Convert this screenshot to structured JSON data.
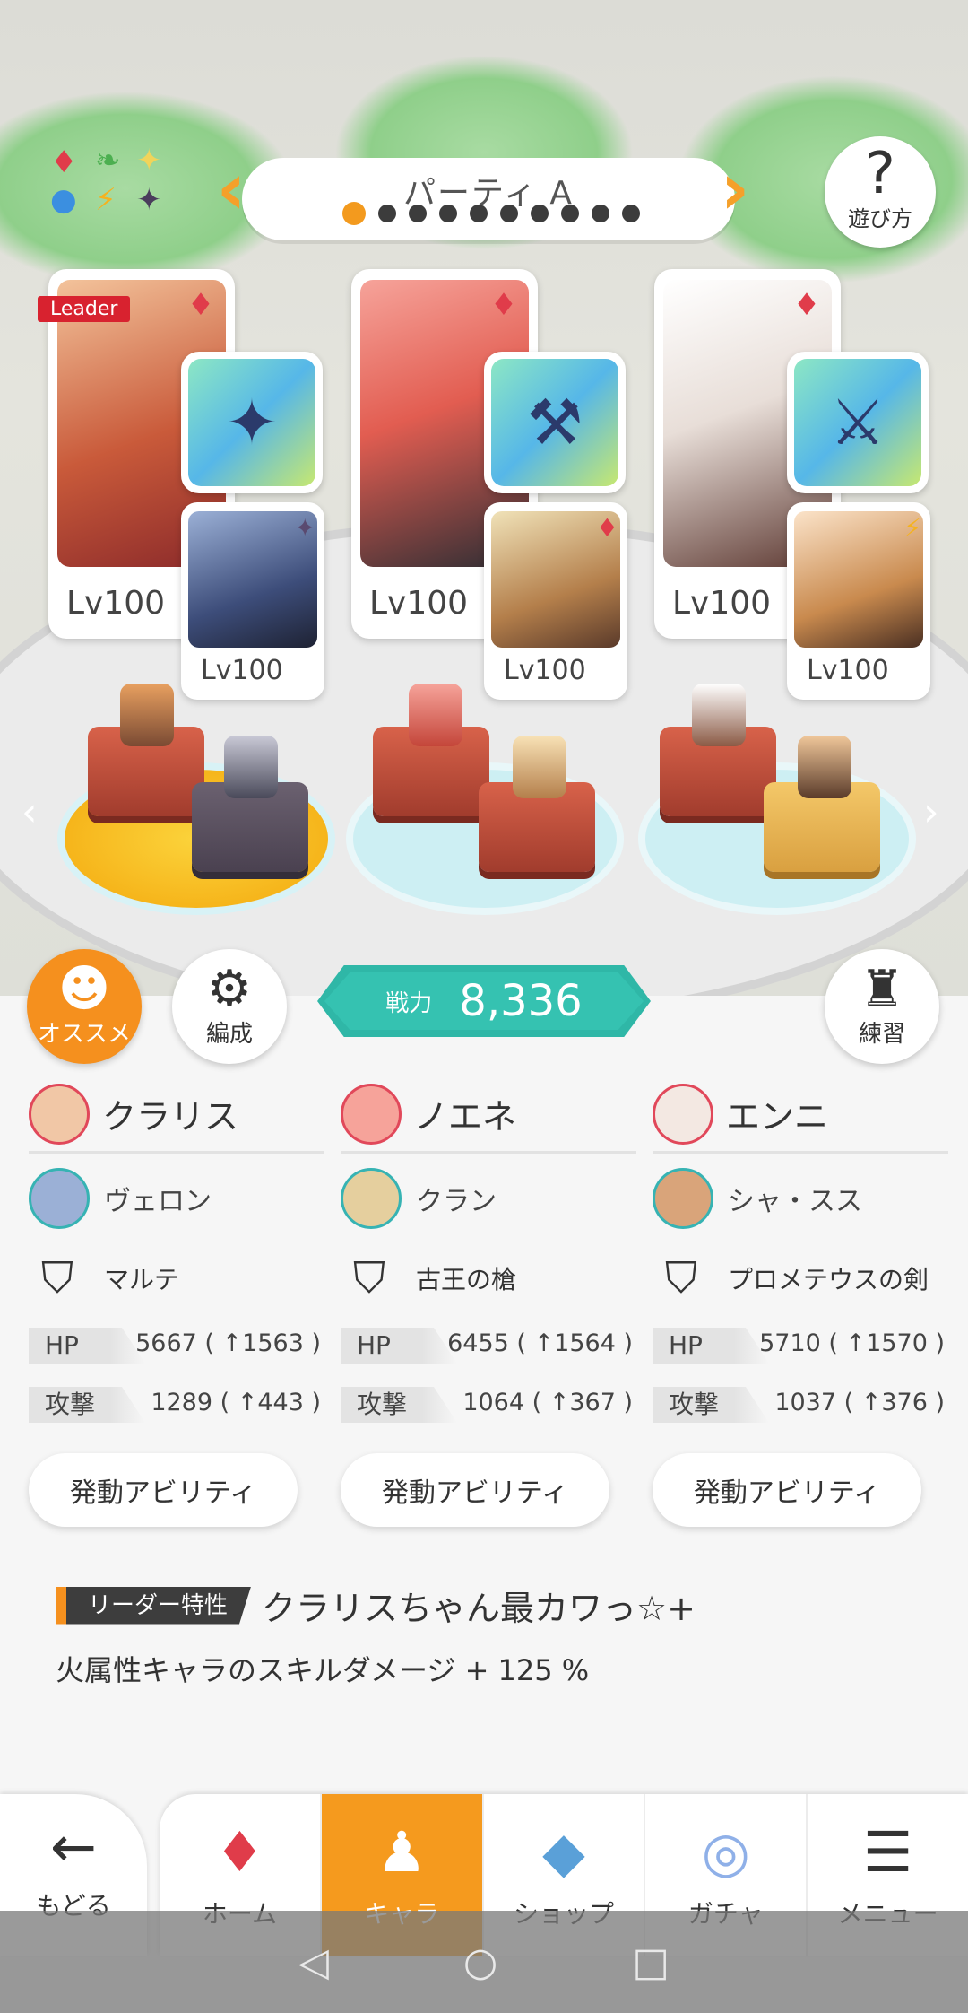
{
  "scene": {
    "party_title": "パーティ A",
    "party_dots": [
      true,
      false,
      false,
      false,
      false,
      false,
      false,
      false,
      false,
      false
    ],
    "help_label": "遊び方",
    "leader_tag": "Leader",
    "element_icons": [
      "♦",
      "❧",
      "✦",
      "●",
      "⚡",
      "✦"
    ],
    "cards": [
      {
        "lv": "Lv100",
        "elem": "♦",
        "art": "art-warm",
        "leader": true,
        "weapon_icon": "✦",
        "sub_lv": "Lv100",
        "sub_elem": "✦",
        "sub_elem_color": "#5a4a70"
      },
      {
        "lv": "Lv100",
        "elem": "♦",
        "art": "art-pink",
        "leader": false,
        "weapon_icon": "⚒",
        "sub_lv": "Lv100",
        "sub_elem": "♦",
        "sub_elem_color": "#e03c4a"
      },
      {
        "lv": "Lv100",
        "elem": "♦",
        "art": "art-white",
        "leader": false,
        "weapon_icon": "⚔",
        "sub_lv": "Lv100",
        "sub_elem": "⚡",
        "sub_elem_color": "#f5b21e"
      }
    ]
  },
  "buttons": {
    "recommend": "オススメ",
    "formation": "編成",
    "practice": "練習"
  },
  "power": {
    "label": "戦力",
    "value": "8,336"
  },
  "party": [
    {
      "leader": "クラリス",
      "sub": "ヴェロン",
      "weapon": "マルテ",
      "hp_label": "HP",
      "hp": "5667 ( ↑1563 )",
      "atk_label": "攻撃",
      "atk": "1289 ( ↑443 )",
      "ability": "発動アビリティ"
    },
    {
      "leader": "ノエネ",
      "sub": "クラン",
      "weapon": "古王の槍",
      "hp_label": "HP",
      "hp": "6455 ( ↑1564 )",
      "atk_label": "攻撃",
      "atk": "1064 ( ↑367 )",
      "ability": "発動アビリティ"
    },
    {
      "leader": "エンニ",
      "sub": "シャ・スス",
      "weapon": "プロメテウスの剣",
      "hp_label": "HP",
      "hp": "5710 ( ↑1570 )",
      "atk_label": "攻撃",
      "atk": "1037 ( ↑376 )",
      "ability": "発動アビリティ"
    }
  ],
  "leader_trait": {
    "badge": "リーダー特性",
    "skill": "クラリスちゃん最カワっ☆+",
    "description": "火属性キャラのスキルダメージ + 125 %"
  },
  "nav": {
    "back": "もどる",
    "tabs": [
      {
        "label": "ホーム",
        "icon": "♦",
        "active": false
      },
      {
        "label": "キャラ",
        "icon": "♟",
        "active": true
      },
      {
        "label": "ショップ",
        "icon": "◆",
        "active": false
      },
      {
        "label": "ガチャ",
        "icon": "◎",
        "active": false
      },
      {
        "label": "メニュー",
        "icon": "☰",
        "active": false
      }
    ]
  },
  "colors": {
    "accent_orange": "#f5901e",
    "teal": "#35c2b1",
    "fire_red": "#e03c4a"
  }
}
